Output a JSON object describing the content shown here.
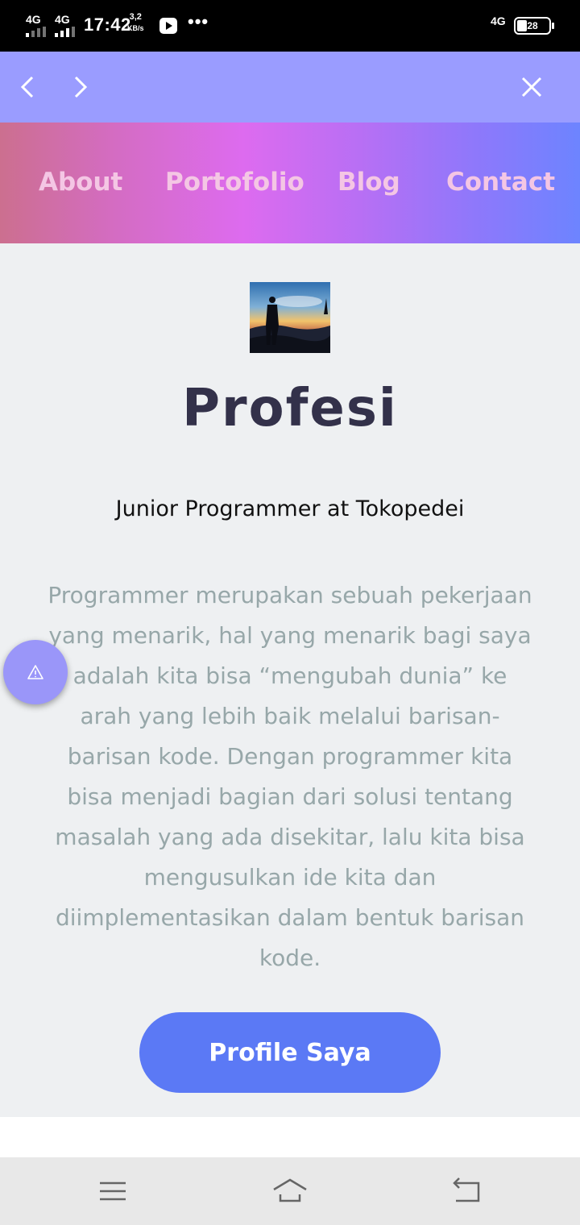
{
  "status_bar": {
    "signal_1": "4G",
    "signal_2": "4G",
    "time": "17:42",
    "speed_value": "3,2",
    "speed_unit": "KB/s",
    "more": "•••",
    "network": "4G",
    "battery": "28"
  },
  "browser_bar": {
    "icons": [
      "chevron-left-icon",
      "chevron-right-icon",
      "close-icon"
    ]
  },
  "nav": {
    "items": [
      {
        "label": "About"
      },
      {
        "label": "Portofolio"
      },
      {
        "label": "Blog"
      },
      {
        "label": "Contact"
      }
    ]
  },
  "main": {
    "title": "Profesi",
    "subtitle": "Junior Programmer at Tokopedei",
    "description": "Programmer merupakan sebuah pekerjaan yang menarik, hal yang menarik bagi saya adalah kita bisa “mengubah dunia” ke arah yang lebih baik melalui barisan- barisan kode. Dengan programmer kita bisa menjadi bagian dari solusi tentang masalah yang ada disekitar, lalu kita bisa mengusulkan ide kita dan diimplementasikan dalam bentuk barisan kode.",
    "cta_label": "Profile Saya"
  },
  "fab": {
    "icon": "warning-icon"
  },
  "system_nav": {
    "icons": [
      "menu-icon",
      "home-icon",
      "back-icon"
    ]
  },
  "colors": {
    "browser_bar": "#9a9cff",
    "nav_gradient_start": "#cc6f8f",
    "nav_gradient_mid": "#dd6bef",
    "nav_gradient_end": "#6d84ff",
    "nav_text": "#f4c6e4",
    "title_text": "#33314a",
    "description_text": "#97a7a9",
    "cta_background": "#5b79f5",
    "fab_background": "#9a96f9",
    "page_background": "#eef0f2"
  }
}
